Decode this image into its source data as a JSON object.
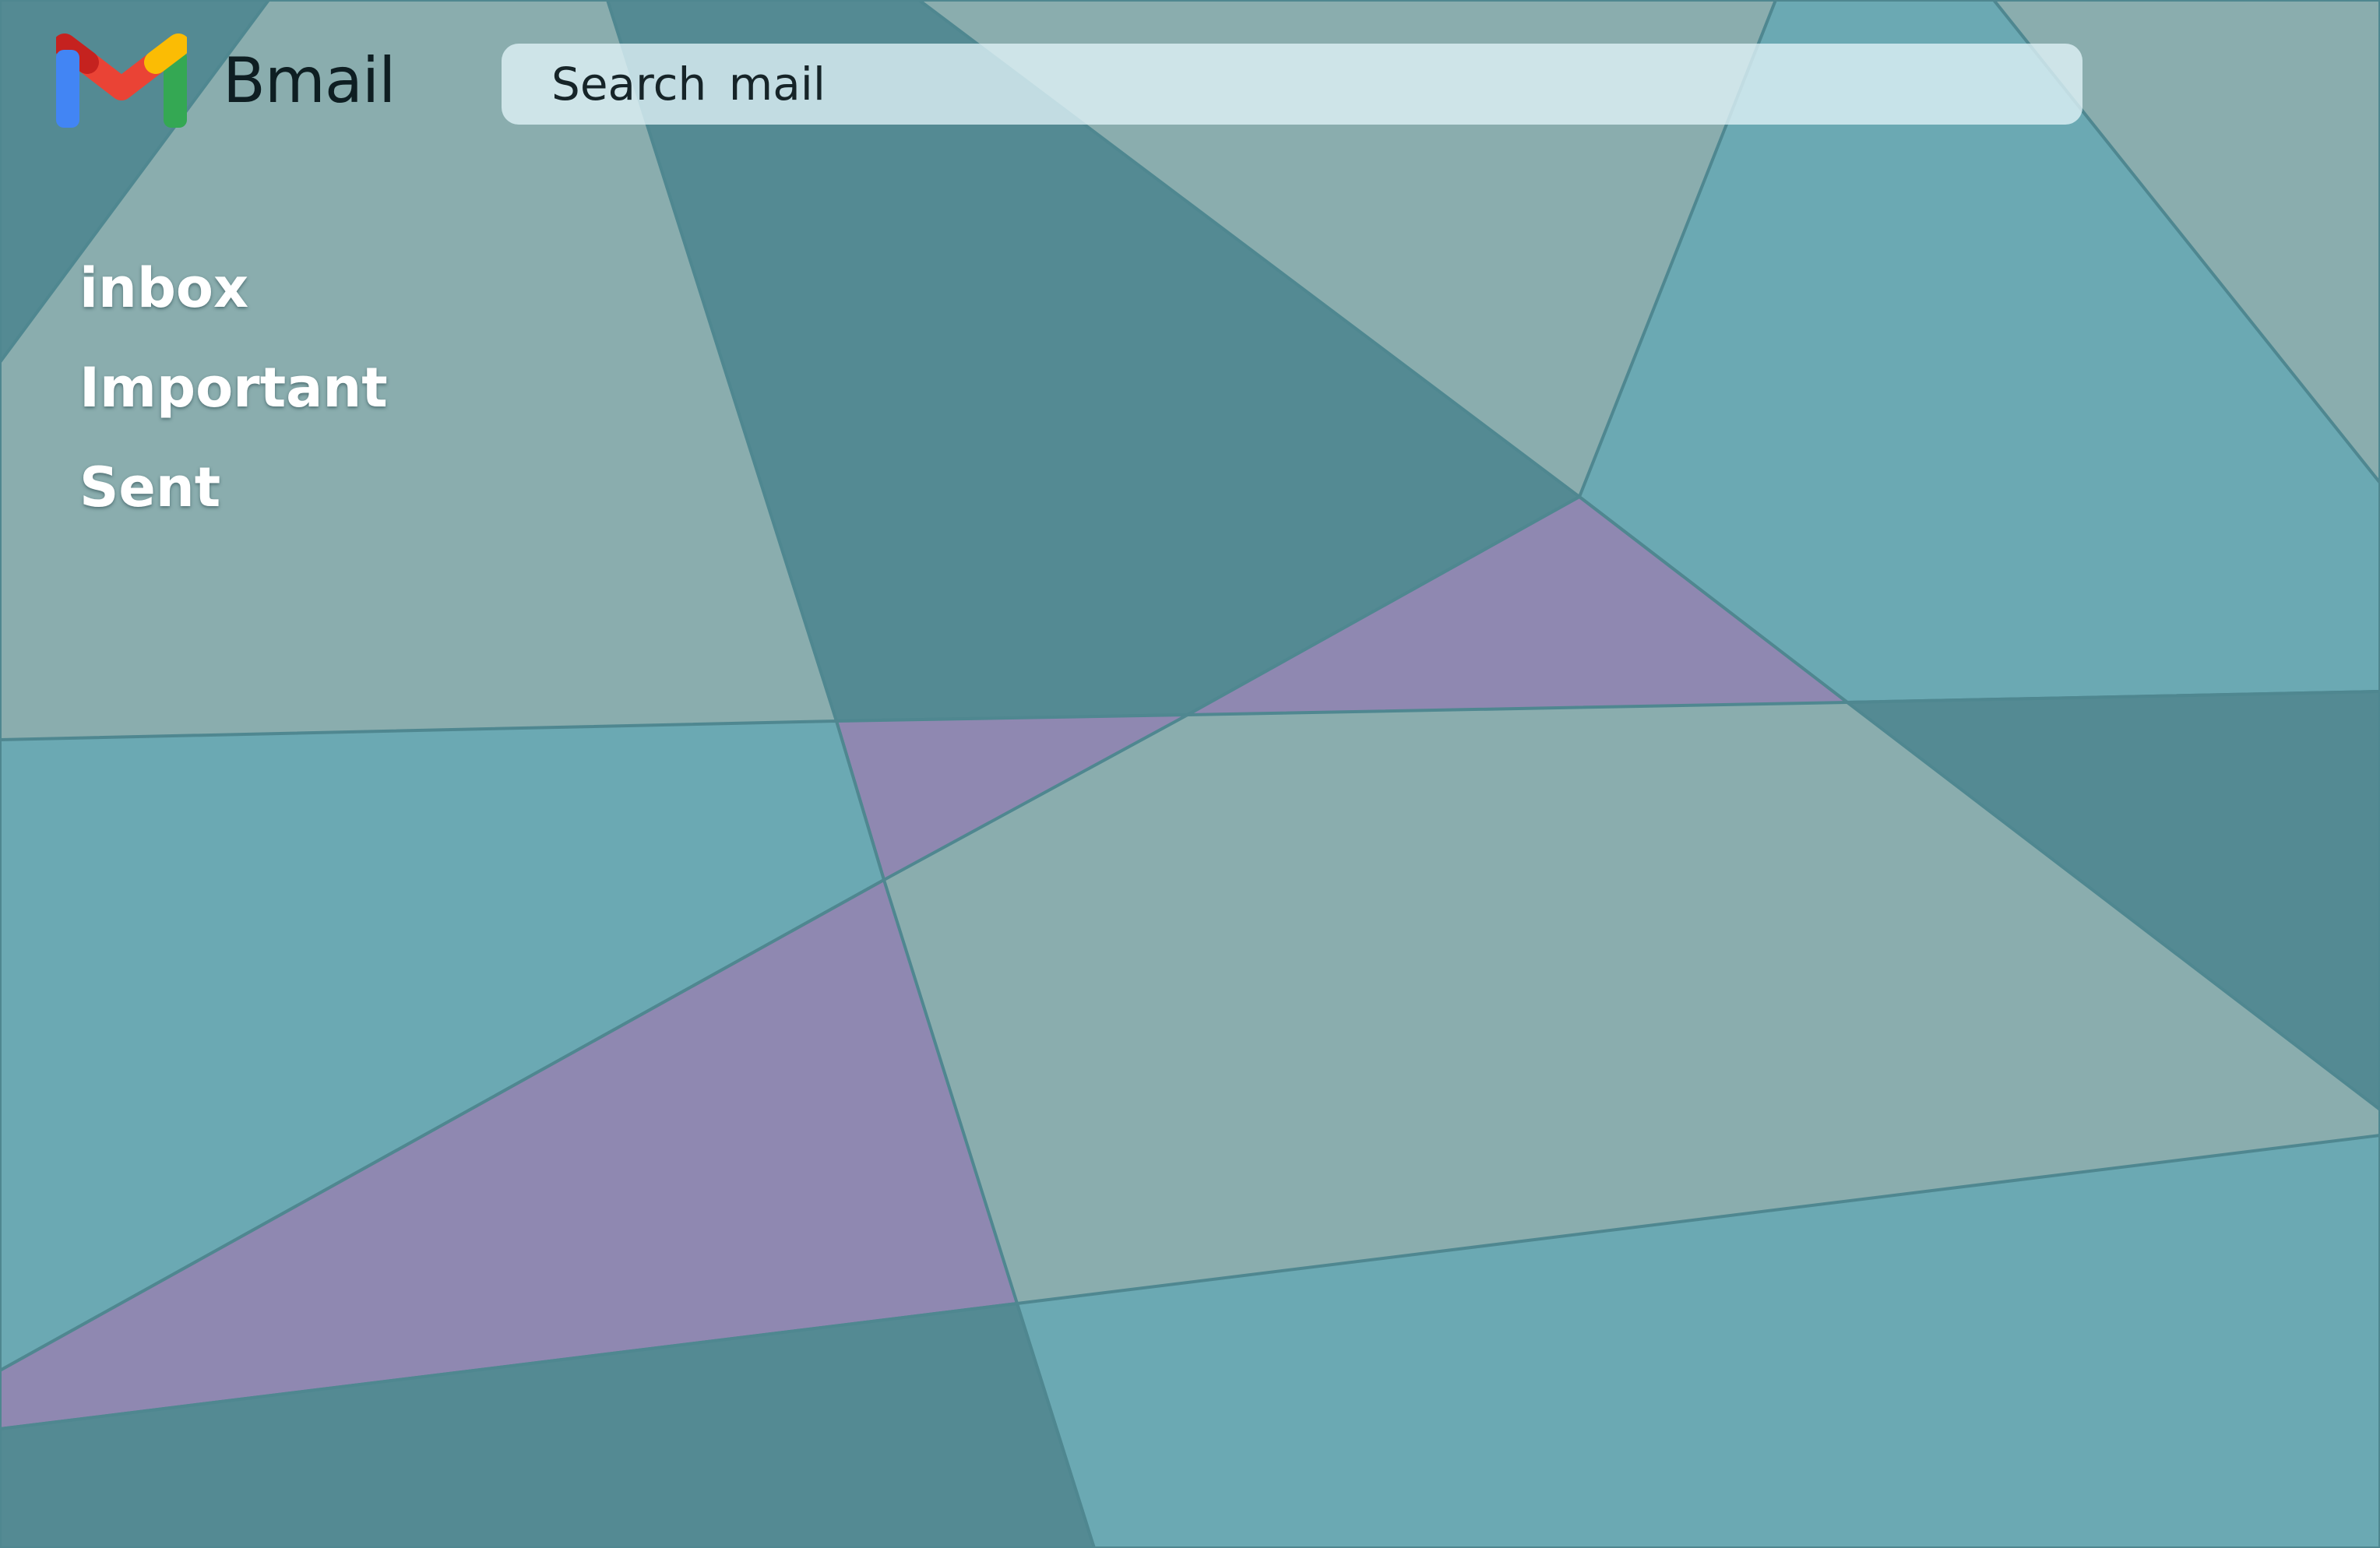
{
  "app": {
    "name": "Bmail",
    "logo_icon": "gmail-m-logo-icon"
  },
  "search": {
    "placeholder": "Search  mail"
  },
  "sidebar": {
    "items": [
      {
        "label": "inbox"
      },
      {
        "label": "Important"
      },
      {
        "label": "Sent"
      }
    ]
  },
  "wallpaper": {
    "style": "low-poly geometric",
    "colors": {
      "slate_teal": "#8aadae",
      "dark_teal": "#548a93",
      "light_teal": "#6ba9b3",
      "lavender": "#8f88b1",
      "edge": "#4f8790"
    }
  },
  "logo_colors": {
    "red": "#ea4335",
    "dark_red": "#c5221f",
    "blue": "#4285f4",
    "green": "#34a853",
    "yellow": "#fbbc04"
  }
}
